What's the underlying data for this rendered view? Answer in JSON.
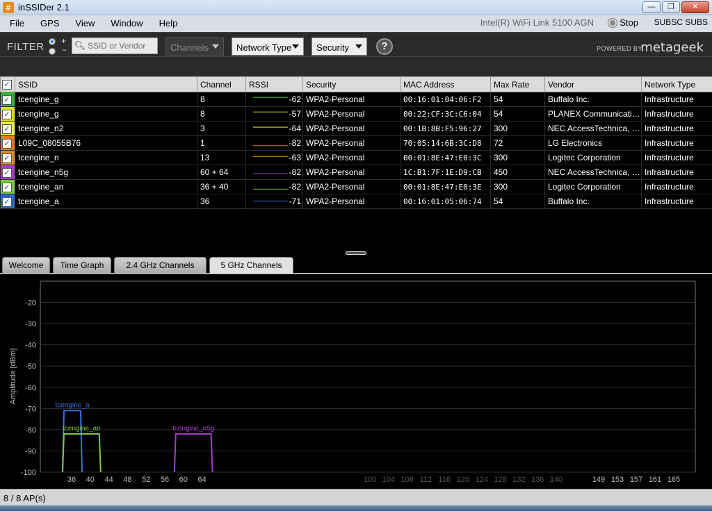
{
  "window": {
    "title": "inSSIDer 2.1",
    "app_icon": "#",
    "minimize_glyph": "—",
    "restore_glyph": "❐",
    "close_glyph": "✕"
  },
  "menu": {
    "items": [
      "File",
      "GPS",
      "View",
      "Window",
      "Help"
    ],
    "adapter": "Intel(R) WiFi Link 5100 AGN",
    "stop_label": "Stop",
    "subsc_label": "SUBSC SUBS"
  },
  "filter": {
    "label": "FILTER",
    "plus": "+",
    "minus": "−",
    "search_placeholder": "SSID or Vendor",
    "channels": "Channels",
    "network_type": "Network Type",
    "security": "Security",
    "help": "?",
    "powered_by": "POWERED BY",
    "brand": "metageek"
  },
  "table": {
    "columns": [
      "SSID",
      "Channel",
      "RSSI",
      "Security",
      "MAC Address",
      "Max Rate",
      "Vendor",
      "Network Type"
    ],
    "rows": [
      {
        "color": "#2db82d",
        "ssid": "tcengine_g",
        "channel": "8",
        "rssi": "-62",
        "security": "WPA2-Personal",
        "mac": "00:16:01:04:06:F2",
        "rate": "54",
        "vendor": "Buffalo Inc.",
        "type": "Infrastructure"
      },
      {
        "color": "#e0e020",
        "ssid": "tcengine_g",
        "channel": "8",
        "rssi": "-57",
        "security": "WPA2-Personal",
        "mac": "00:22:CF:3C:C6:04",
        "rate": "54",
        "vendor": "PLANEX Communication…",
        "type": "Infrastructure"
      },
      {
        "color": "#f0f040",
        "ssid": "tcengine_n2",
        "channel": "3",
        "rssi": "-64",
        "security": "WPA2-Personal",
        "mac": "00:1B:8B:F5:96:27",
        "rate": "300",
        "vendor": "NEC AccessTechnica, Lt…",
        "type": "Infrastructure"
      },
      {
        "color": "#e07a1c",
        "ssid": "L09C_08055B76",
        "channel": "1",
        "rssi": "-82",
        "security": "WPA2-Personal",
        "mac": "70:05:14:6B:3C:D8",
        "rate": "72",
        "vendor": "LG Electronics",
        "type": "Infrastructure"
      },
      {
        "color": "#e08a20",
        "ssid": "tcengine_n",
        "channel": "13",
        "rssi": "-63",
        "security": "WPA2-Personal",
        "mac": "00:01:8E:47:E0:3C",
        "rate": "300",
        "vendor": "Logitec Corporation",
        "type": "Infrastructure"
      },
      {
        "color": "#a43cc8",
        "ssid": "tcengine_n5g",
        "channel": "60 + 64",
        "rssi": "-82",
        "security": "WPA2-Personal",
        "mac": "1C:B1:7F:1E:D9:CB",
        "rate": "450",
        "vendor": "NEC AccessTechnica, Lt…",
        "type": "Infrastructure"
      },
      {
        "color": "#7ac840",
        "ssid": "tcengine_an",
        "channel": "36 + 40",
        "rssi": "-82",
        "security": "WPA2-Personal",
        "mac": "00:01:8E:47:E0:3E",
        "rate": "300",
        "vendor": "Logitec Corporation",
        "type": "Infrastructure"
      },
      {
        "color": "#2a6ad0",
        "ssid": "tcengine_a",
        "channel": "36",
        "rssi": "-71",
        "security": "WPA2-Personal",
        "mac": "00:16:01:05:06:74",
        "rate": "54",
        "vendor": "Buffalo Inc.",
        "type": "Infrastructure"
      }
    ]
  },
  "tabs": [
    "Welcome",
    "Time Graph",
    "2.4 GHz Channels",
    "5 GHz Channels"
  ],
  "active_tab": "5 GHz Channels",
  "chart_data": {
    "type": "area",
    "ylabel": "Amplitude [dBm]",
    "ylim": [
      -100,
      -10
    ],
    "yticks": [
      -20,
      -30,
      -40,
      -50,
      -60,
      -70,
      -80,
      -90,
      -100
    ],
    "xticks_active": [
      "36",
      "40",
      "44",
      "48",
      "52",
      "56",
      "60",
      "64"
    ],
    "xticks_dim": [
      "100",
      "104",
      "108",
      "112",
      "116",
      "120",
      "124",
      "128",
      "132",
      "136",
      "140"
    ],
    "xticks_upper": [
      "149",
      "153",
      "157",
      "161",
      "165"
    ],
    "series": [
      {
        "name": "tcengine_a",
        "color": "#3a72e0",
        "channels": [
          36
        ],
        "amplitude": -71
      },
      {
        "name": "tcengine_an",
        "color": "#7ac840",
        "channels": [
          36,
          40
        ],
        "amplitude": -82
      },
      {
        "name": "tcengine_n5g",
        "color": "#a43cc8",
        "channels": [
          60,
          64
        ],
        "amplitude": -82
      }
    ]
  },
  "status": {
    "ap_count": "8 / 8 AP(s)"
  }
}
